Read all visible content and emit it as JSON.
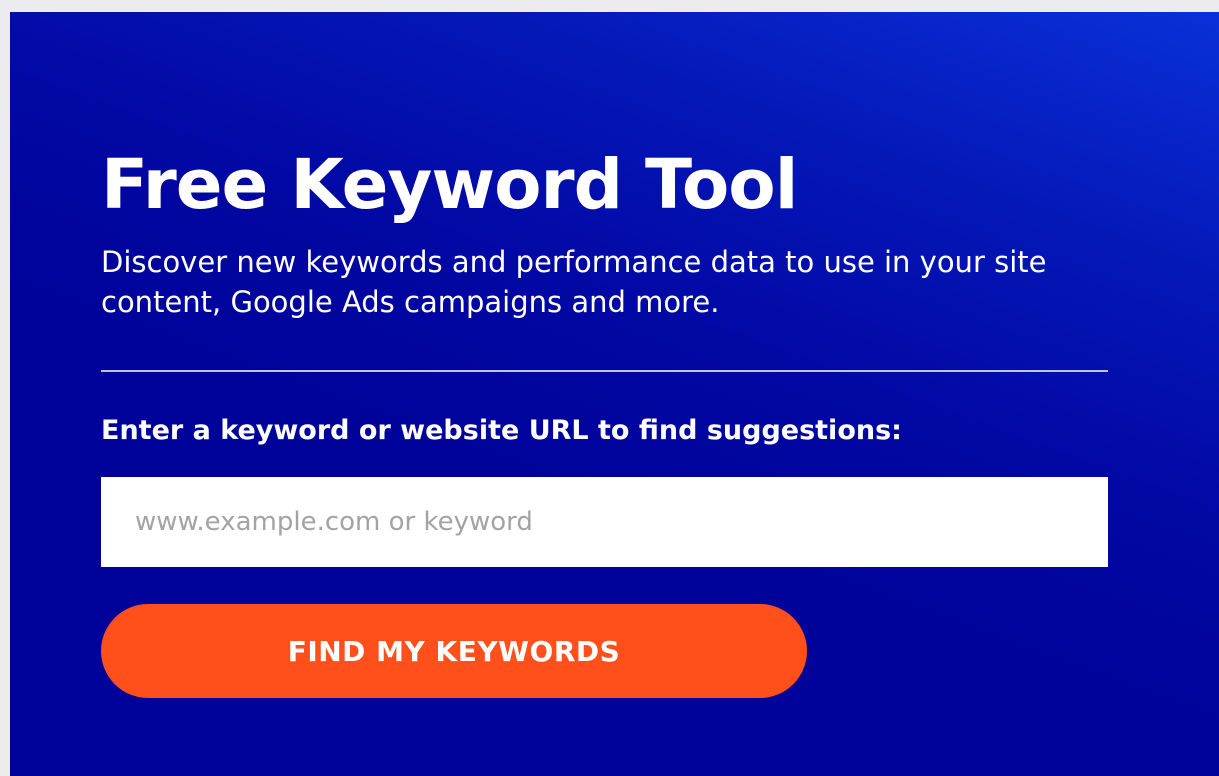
{
  "hero": {
    "title": "Free Keyword Tool",
    "description": "Discover new keywords and performance data to use in your site content, Google Ads campaigns and more."
  },
  "form": {
    "prompt": "Enter a keyword or website URL to find suggestions:",
    "input_value": "",
    "input_placeholder": "www.example.com or keyword",
    "submit_label": "FIND MY KEYWORDS"
  },
  "colors": {
    "background": "#00039a",
    "background_accent": "#0a30d9",
    "button": "#ff4f1a",
    "text": "#ffffff",
    "placeholder": "#a3a3a3"
  }
}
